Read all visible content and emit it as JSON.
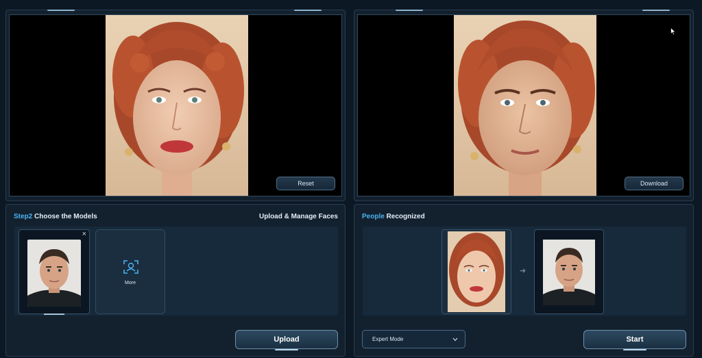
{
  "left_viewer": {
    "reset_label": "Reset"
  },
  "right_viewer": {
    "download_label": "Download"
  },
  "step2": {
    "title_highlight": "Step2",
    "title_rest": " Choose the Models",
    "upload_manage_label": "Upload & Manage Faces",
    "close_glyph": "×",
    "more_label": "More",
    "upload_label": "Upload"
  },
  "recognized": {
    "title_highlight": "People",
    "title_rest": " Recognized",
    "arrow_glyph": "➜",
    "mode_value": "Expert Mode",
    "start_label": "Start"
  },
  "colors": {
    "accent": "#4bb3f0",
    "panel": "#13212f",
    "background": "#0c1824"
  }
}
